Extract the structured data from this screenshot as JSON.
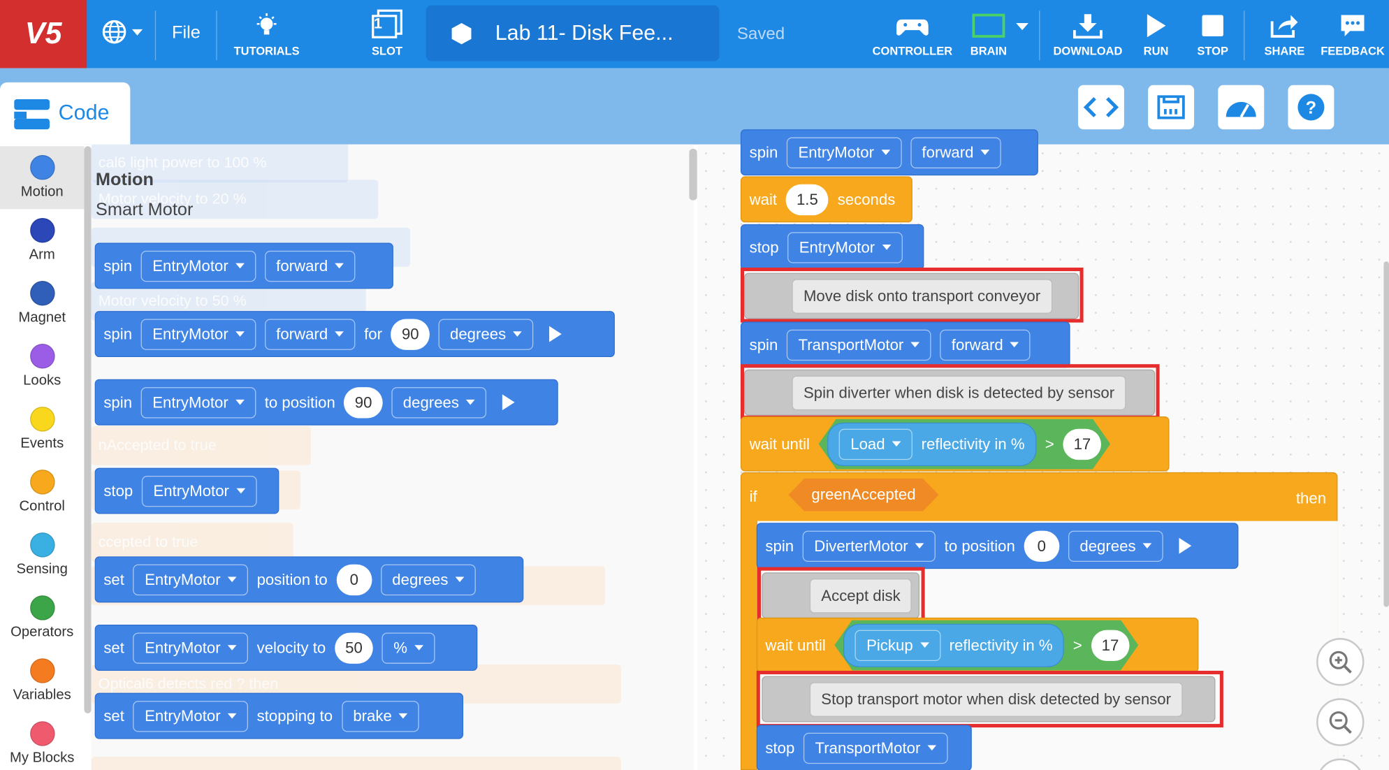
{
  "topbar": {
    "logo": "V5",
    "file": "File",
    "tutorials": "TUTORIALS",
    "slot": "SLOT",
    "slot_number": "1",
    "project_name": "Lab 11- Disk Fee...",
    "saved": "Saved",
    "controller": "CONTROLLER",
    "brain": "BRAIN",
    "download": "DOWNLOAD",
    "run": "RUN",
    "stop": "STOP",
    "share": "SHARE",
    "feedback": "FEEDBACK"
  },
  "tabs": {
    "code": "Code"
  },
  "categories": [
    {
      "label": "Motion",
      "color": "#3f84e5"
    },
    {
      "label": "Arm",
      "color": "#2b47b8"
    },
    {
      "label": "Magnet",
      "color": "#2f5fb8"
    },
    {
      "label": "Looks",
      "color": "#9b5de5"
    },
    {
      "label": "Events",
      "color": "#f9d71c"
    },
    {
      "label": "Control",
      "color": "#f7a81c"
    },
    {
      "label": "Sensing",
      "color": "#3ab0e2"
    },
    {
      "label": "Operators",
      "color": "#3ca548"
    },
    {
      "label": "Variables",
      "color": "#f47b20"
    },
    {
      "label": "My Blocks",
      "color": "#ef5a6f"
    }
  ],
  "palette": {
    "heading": "Motion",
    "subheading": "Smart Motor",
    "blocks": [
      {
        "op": "spin",
        "motor": "EntryMotor",
        "dir": "forward"
      },
      {
        "op": "spin",
        "motor": "EntryMotor",
        "dir": "forward",
        "for": "for",
        "amount": "90",
        "unit": "degrees"
      },
      {
        "op": "spin",
        "motor": "EntryMotor",
        "to": "to position",
        "amount": "90",
        "unit": "degrees"
      },
      {
        "op": "stop",
        "motor": "EntryMotor"
      },
      {
        "op": "set",
        "motor": "EntryMotor",
        "what": "position to",
        "amount": "0",
        "unit": "degrees"
      },
      {
        "op": "set",
        "motor": "EntryMotor",
        "what": "velocity to",
        "amount": "50",
        "unit": "%"
      },
      {
        "op": "set",
        "motor": "EntryMotor",
        "what": "stopping to",
        "mode": "brake"
      }
    ],
    "ghost": [
      "cal6 light power to 100 %",
      "Motor velocity to 20 %",
      "Motor velocity to 50 %",
      "nAccepted to true",
      "ccepted to true",
      "Optical6 detects red ? then"
    ]
  },
  "script": {
    "b1": {
      "op": "spin",
      "motor": "EntryMotor",
      "dir": "forward"
    },
    "b2": {
      "op": "wait",
      "amount": "1.5",
      "unit": "seconds"
    },
    "b3": {
      "op": "stop",
      "motor": "EntryMotor"
    },
    "c1": "Move disk onto transport conveyor",
    "b4": {
      "op": "spin",
      "motor": "TransportMotor",
      "dir": "forward"
    },
    "c2": "Spin diverter when disk is detected by sensor",
    "b5": {
      "op": "wait until",
      "sensor": "Load",
      "prop": "reflectivity in %",
      "cmp": ">",
      "val": "17"
    },
    "b6": {
      "op": "if",
      "var": "greenAccepted",
      "then": "then"
    },
    "b7": {
      "op": "spin",
      "motor": "DiverterMotor",
      "to": "to position",
      "amount": "0",
      "unit": "degrees"
    },
    "c3": "Accept disk",
    "b8": {
      "op": "wait until",
      "sensor": "Pickup",
      "prop": "reflectivity in %",
      "cmp": ">",
      "val": "17"
    },
    "c4": "Stop transport motor when disk detected by sensor",
    "b9": {
      "op": "stop",
      "motor": "TransportMotor"
    }
  },
  "colors": {
    "topbar": "#1e88e5",
    "logo": "#d32f2f",
    "motion": "#3f84e5",
    "control": "#f7a81c",
    "operators": "#5bb55a",
    "sensing": "#4aa8e6",
    "variables": "#f08a24",
    "comment": "#c6c6c6",
    "highlight": "#e52d2d"
  }
}
